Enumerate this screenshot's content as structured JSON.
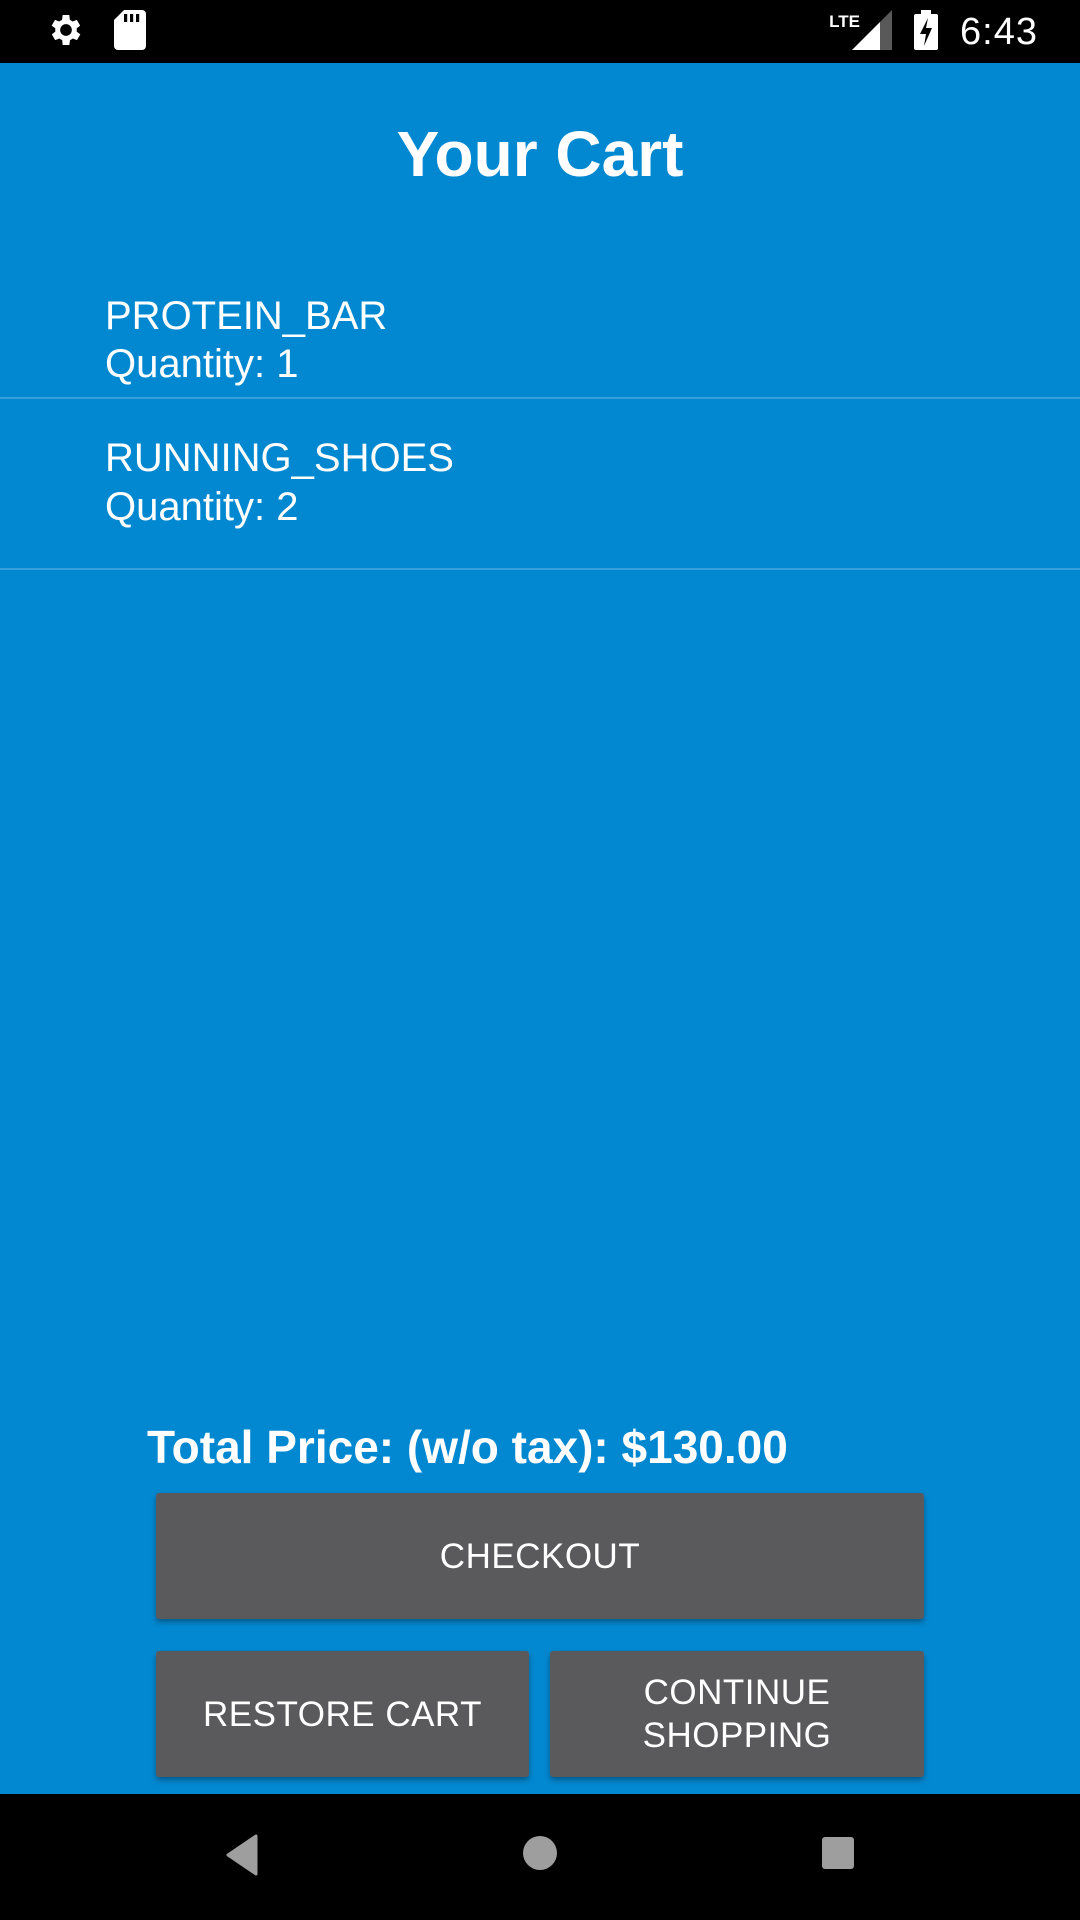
{
  "status_bar": {
    "time": "6:43",
    "network": "LTE",
    "icons": [
      "settings-icon",
      "sd-card-icon",
      "signal-icon",
      "battery-charging-icon"
    ]
  },
  "cart": {
    "title": "Your Cart",
    "items": [
      {
        "name": "PROTEIN_BAR",
        "quantity": "Quantity: 1"
      },
      {
        "name": "RUNNING_SHOES",
        "quantity": "Quantity: 2"
      }
    ],
    "total": "Total Price: (w/o tax): $130.00"
  },
  "buttons": {
    "checkout": "CHECKOUT",
    "restore": "RESTORE CART",
    "continue_line1": "CONTINUE",
    "continue_line2": "SHOPPING"
  },
  "nav_bar": {
    "icons": [
      "back-icon",
      "home-icon",
      "recents-icon"
    ]
  },
  "colors": {
    "app_background": "#0288d1",
    "button": "#5a5a5c",
    "text": "#ffffff"
  }
}
